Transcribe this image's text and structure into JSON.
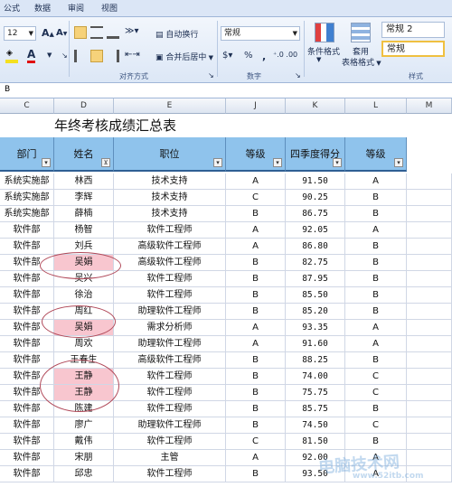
{
  "ribbon_tabs": [
    "公式",
    "数据",
    "审阅",
    "视图"
  ],
  "ribbon": {
    "font_size": "12",
    "grow_font": "A",
    "shrink_font": "A",
    "font_color_letter": "A",
    "wrap_text": "自动换行",
    "merge_center": "合并后居中",
    "number_format": "常规",
    "percent": "%",
    "comma": ",",
    "cond_format": "条件格式",
    "table_format_1": "套用",
    "table_format_2": "表格格式",
    "style_1": "常规 2",
    "style_2": "常规",
    "group_alignment": "对齐方式",
    "group_number": "数字",
    "group_styles": "样式"
  },
  "formula_bar": {
    "value": "B"
  },
  "columns": [
    "C",
    "D",
    "E",
    "J",
    "K",
    "L",
    "M"
  ],
  "title": "年终考核成绩汇总表",
  "headers": [
    "部门",
    "姓名",
    "职位",
    "等级",
    "四季度得分",
    "等级"
  ],
  "rows": [
    [
      "系统实施部",
      "林西",
      "技术支持",
      "A",
      "91.50",
      "A"
    ],
    [
      "系统实施部",
      "李辉",
      "技术支持",
      "C",
      "90.25",
      "B"
    ],
    [
      "系统实施部",
      "薛楠",
      "技术支持",
      "B",
      "86.75",
      "B"
    ],
    [
      "软件部",
      "杨智",
      "软件工程师",
      "A",
      "92.05",
      "A"
    ],
    [
      "软件部",
      "刘兵",
      "高级软件工程师",
      "A",
      "86.80",
      "B"
    ],
    [
      "软件部",
      "吴娟",
      "高级软件工程师",
      "B",
      "82.75",
      "B"
    ],
    [
      "软件部",
      "吴兴",
      "软件工程师",
      "B",
      "87.95",
      "B"
    ],
    [
      "软件部",
      "徐治",
      "软件工程师",
      "B",
      "85.50",
      "B"
    ],
    [
      "软件部",
      "周红",
      "助理软件工程师",
      "B",
      "85.20",
      "B"
    ],
    [
      "软件部",
      "吴娟",
      "需求分析师",
      "A",
      "93.35",
      "A"
    ],
    [
      "软件部",
      "周欢",
      "助理软件工程师",
      "A",
      "91.60",
      "A"
    ],
    [
      "软件部",
      "王春生",
      "高级软件工程师",
      "B",
      "88.25",
      "B"
    ],
    [
      "软件部",
      "王静",
      "软件工程师",
      "B",
      "74.00",
      "C"
    ],
    [
      "软件部",
      "王静",
      "软件工程师",
      "B",
      "75.75",
      "C"
    ],
    [
      "软件部",
      "陈建",
      "软件工程师",
      "B",
      "85.75",
      "B"
    ],
    [
      "软件部",
      "廖广",
      "助理软件工程师",
      "B",
      "74.50",
      "C"
    ],
    [
      "软件部",
      "戴伟",
      "软件工程师",
      "C",
      "81.50",
      "B"
    ],
    [
      "软件部",
      "宋朋",
      "主管",
      "A",
      "92.00",
      "A"
    ],
    [
      "软件部",
      "邱忠",
      "软件工程师",
      "B",
      "93.50",
      "A"
    ]
  ],
  "highlighted_rows": [
    5,
    9,
    12,
    13
  ],
  "colors": {
    "header_fill": "#8fc3ec",
    "highlight_fill": "#f8c6cf",
    "oval_stroke": "#b14a5a"
  }
}
